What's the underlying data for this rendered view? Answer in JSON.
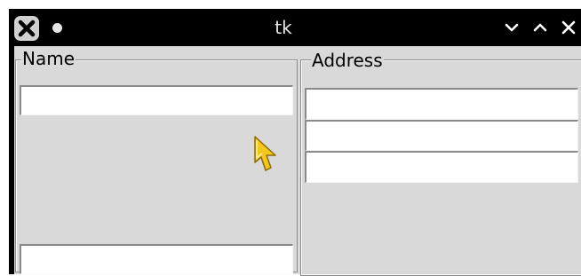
{
  "window": {
    "title": "tk"
  },
  "titlebar": {
    "close_icon": "close-x-icon",
    "menu_icon": "window-menu-dot-icon",
    "minimize_icon": "chevron-down-icon",
    "maximize_icon": "chevron-up-icon",
    "close_right_icon": "close-icon"
  },
  "name_frame": {
    "label": "Name",
    "entries": [
      {
        "value": ""
      },
      {
        "value": ""
      }
    ]
  },
  "address_frame": {
    "label": "Address",
    "entries": [
      {
        "value": ""
      },
      {
        "value": ""
      },
      {
        "value": ""
      }
    ]
  },
  "colors": {
    "titlebar": "#000000",
    "background": "#d9d9d9",
    "entry": "#ffffff",
    "cursor": "#f2c81e"
  },
  "cursor_icon": "mouse-pointer-icon"
}
